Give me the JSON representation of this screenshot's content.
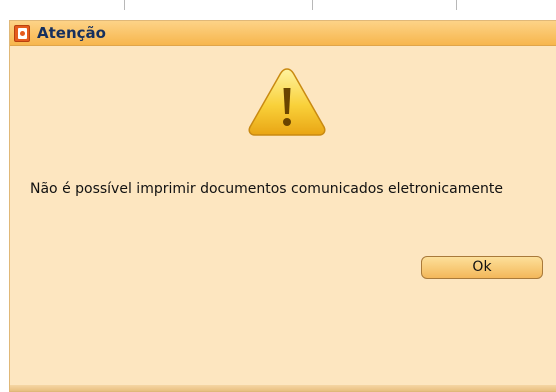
{
  "dialog": {
    "title": "Atenção",
    "title_icon": "document-alert-icon",
    "warning_icon": "warning-triangle-icon",
    "message": "Não é possível imprimir documentos comunicados eletronicamente",
    "ok_label": "Ok"
  },
  "colors": {
    "dialog_background": "#fde6c0",
    "titlebar": "#f7b64d",
    "title_text": "#16305e",
    "button": "#f3b75a"
  }
}
